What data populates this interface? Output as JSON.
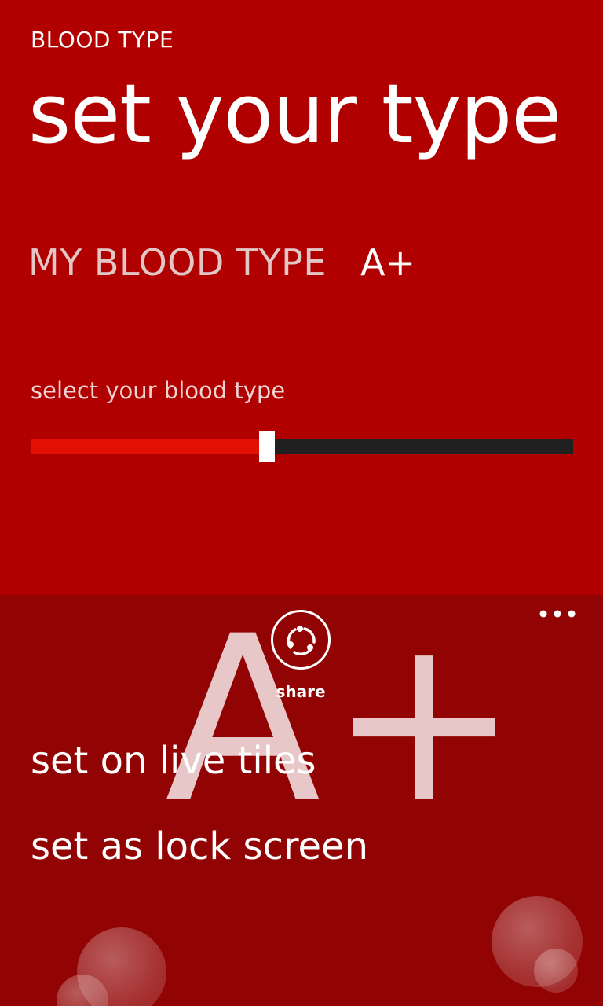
{
  "header": {
    "app_title": "BLOOD TYPE",
    "page_title": "set your type"
  },
  "blood_type": {
    "label": "MY BLOOD TYPE",
    "value": "A+"
  },
  "slider": {
    "label": "select your blood type",
    "value_fraction": 0.435
  },
  "app_bar": {
    "big_type": "A+",
    "share_icon": "share-icon",
    "share_label": "share",
    "more_icon": "more-dots-icon",
    "menu_items": [
      {
        "label": "set on live tiles"
      },
      {
        "label": "set as lock screen"
      }
    ]
  },
  "colors": {
    "background": "#b00000",
    "app_bar": "#920404",
    "slider_fill": "#e31104",
    "slider_track": "#202020"
  }
}
